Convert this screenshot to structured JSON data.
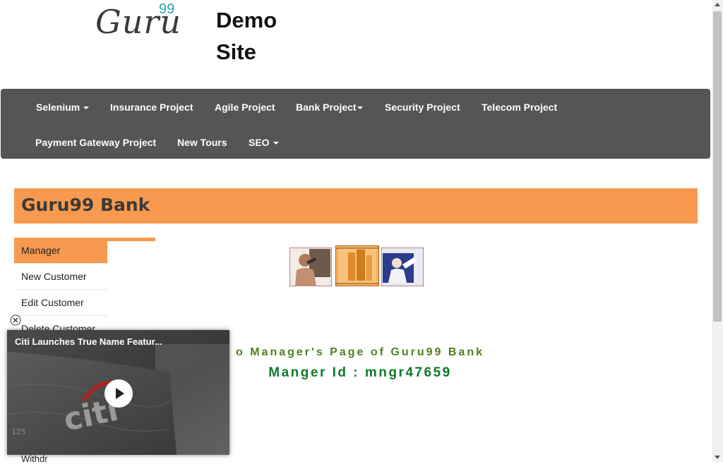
{
  "header": {
    "logo_text": "Guru",
    "logo_sup": "99",
    "site_title": "Demo Site"
  },
  "nav": {
    "items": [
      {
        "label": "Selenium",
        "has_caret": true
      },
      {
        "label": "Insurance Project",
        "has_caret": false
      },
      {
        "label": "Agile Project",
        "has_caret": false
      },
      {
        "label": "Bank Project",
        "has_caret": true
      },
      {
        "label": "Security Project",
        "has_caret": false
      },
      {
        "label": "Telecom Project",
        "has_caret": false
      },
      {
        "label": "Payment Gateway Project",
        "has_caret": false
      },
      {
        "label": "New Tours",
        "has_caret": false
      },
      {
        "label": "SEO",
        "has_caret": true
      }
    ]
  },
  "banner": {
    "title": "Guru99 Bank"
  },
  "sidebar": {
    "items": [
      {
        "label": "Manager"
      },
      {
        "label": "New Customer"
      },
      {
        "label": "Edit Customer"
      },
      {
        "label": "Delete Customer"
      },
      {
        "label": "Withdr"
      }
    ]
  },
  "main": {
    "welcome": "o Manager's Page of Guru99 Bank",
    "manager_id": "Manger Id : mngr47659"
  },
  "video": {
    "title": "Citi Launches True Name Featur...",
    "brand_text": "citi",
    "card_number": "125"
  },
  "colors": {
    "accent": "#f79a4f",
    "navbar": "#555555",
    "welcome_text": "#4f7f1f",
    "manager_id_text": "#0d7a2a",
    "logo_sup": "#2aa3b1"
  }
}
